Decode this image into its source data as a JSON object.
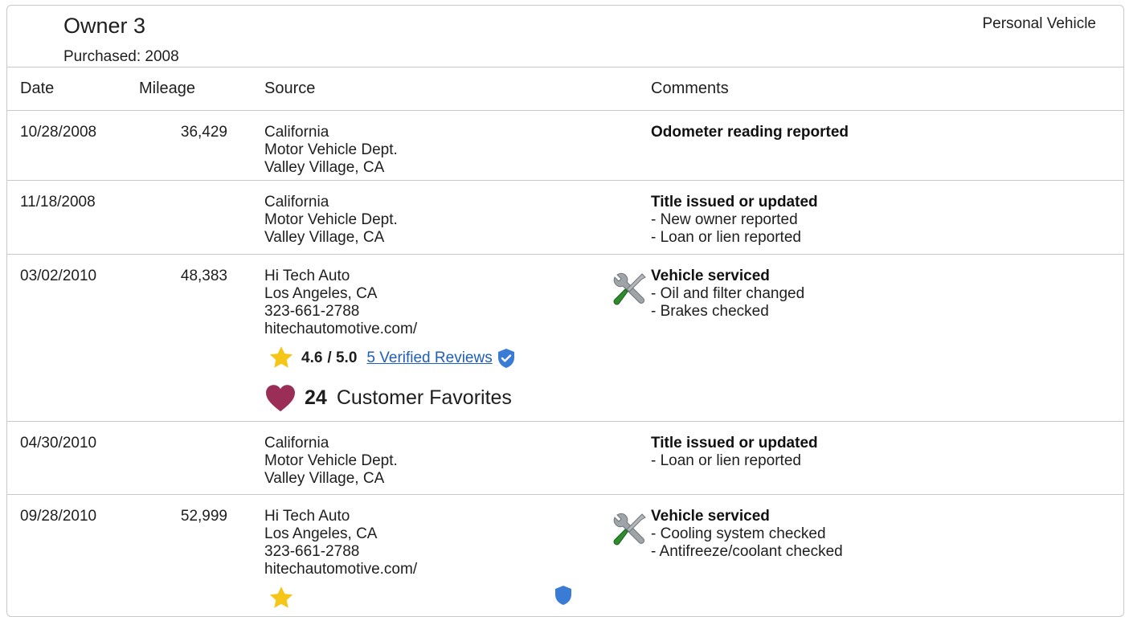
{
  "owner": {
    "title": "Owner 3",
    "purchased": "Purchased: 2008",
    "vehicle_type": "Personal Vehicle"
  },
  "columns": {
    "date": "Date",
    "mileage": "Mileage",
    "source": "Source",
    "comments": "Comments"
  },
  "rows": [
    {
      "date": "10/28/2008",
      "mileage": "36,429",
      "source": [
        "California",
        "Motor Vehicle Dept.",
        "Valley Village, CA"
      ],
      "comment_head": "Odometer reading reported",
      "comment_lines": []
    },
    {
      "date": "11/18/2008",
      "mileage": "",
      "source": [
        "California",
        "Motor Vehicle Dept.",
        "Valley Village, CA"
      ],
      "comment_head": "Title issued or updated",
      "comment_lines": [
        "- New owner reported",
        "- Loan or lien reported"
      ]
    },
    {
      "date": "03/02/2010",
      "mileage": "48,383",
      "source": [
        "Hi Tech Auto",
        "Los Angeles, CA",
        "323-661-2788",
        "hitechautomotive.com/"
      ],
      "comment_head": "Vehicle serviced",
      "comment_lines": [
        "- Oil and filter changed",
        "- Brakes checked"
      ],
      "rating": "4.6",
      "rating_max": "/ 5.0",
      "reviews": "5 Verified Reviews",
      "favorites_count": "24",
      "favorites_label": "Customer Favorites"
    },
    {
      "date": "04/30/2010",
      "mileage": "",
      "source": [
        "California",
        "Motor Vehicle Dept.",
        "Valley Village, CA"
      ],
      "comment_head": "Title issued or updated",
      "comment_lines": [
        "- Loan or lien reported"
      ]
    },
    {
      "date": "09/28/2010",
      "mileage": "52,999",
      "source": [
        "Hi Tech Auto",
        "Los Angeles, CA",
        "323-661-2788",
        "hitechautomotive.com/"
      ],
      "comment_head": "Vehicle serviced",
      "comment_lines": [
        "- Cooling system checked",
        "- Antifreeze/coolant checked"
      ]
    }
  ],
  "colors": {
    "star": "#f5c518",
    "heart": "#9b2e56",
    "verified": "#3a7bd5",
    "link": "#1f5fb5",
    "border": "#c9c9c9"
  },
  "icons": {
    "service": "wrench-screwdriver-icon",
    "star": "star-icon",
    "verified": "verified-shield-icon",
    "heart": "heart-icon"
  }
}
